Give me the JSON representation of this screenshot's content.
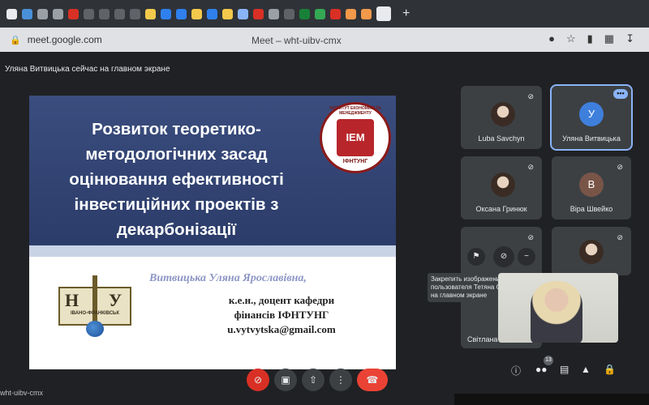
{
  "browser": {
    "tab_colors": [
      "#e8eaed",
      "#4a90d9",
      "#9aa0a6",
      "#9aa0a6",
      "#d93025",
      "#5f6368",
      "#5f6368",
      "#5f6368",
      "#5f6368",
      "#f2c94c",
      "#2f80ed",
      "#2f80ed",
      "#f2c94c",
      "#2f80ed",
      "#f2c94c",
      "#8ab4f8",
      "#d93025",
      "#9aa0a6",
      "#5f6368",
      "#188038",
      "#34a853",
      "#d93025",
      "#f2994a",
      "#f2994a",
      "#e8eaed"
    ],
    "new_tab": "+",
    "url": "meet.google.com",
    "title": "Meet – wht-uibv-cmx"
  },
  "meet": {
    "presenting_note": "Уляна Витвицька сейчас на главном экране",
    "slide": {
      "title_lines": [
        "Розвиток теоретико-",
        "методологічних засад",
        "оцінювання ефективності",
        "інвестиційних проектів з",
        "декарбонізації"
      ],
      "iem_logo_text": "IEM",
      "iem_ring_text": "ІНСТИТУТ ЕКОНОМІКИ ТА МЕНЕДЖМЕНТУ",
      "iem_bottom_text": "ІФНТУНГ",
      "author": "Витвицька Уляна Ярославівна,",
      "details_lines": [
        "к.е.н., доцент кафедри",
        "фінансів ІФНТУНГ",
        "u.vytvytska@gmail.com"
      ],
      "uni_logo_letters": [
        "Н",
        "У"
      ],
      "uni_logo_caption": "ІВАНО-ФРАНКІВСЬК"
    },
    "participants": [
      {
        "name": "Luba Savchyn"
      },
      {
        "name": "Уляна Витвицька",
        "initial": "У",
        "color": "#3f7fdc"
      },
      {
        "name": "Оксана Гринюк"
      },
      {
        "name": "Віра Швейко",
        "initial": "В",
        "color": "#795548"
      },
      {
        "name": "Світлана"
      }
    ],
    "tooltip": "Закрепить изображение пользователя Тетяна Орищин на главном экране",
    "more_dots": "•••",
    "meeting_code": "wht-uibv-cmx",
    "participant_count": "13",
    "mic_icon": "mic-off-icon"
  }
}
